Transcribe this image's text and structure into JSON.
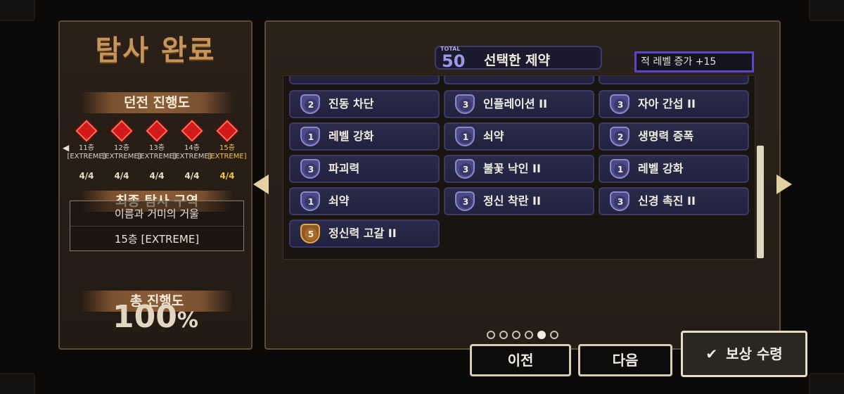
{
  "left_panel": {
    "title": "탐사 완료",
    "dungeon_progress_label": "던전 진행도",
    "floors": [
      {
        "label": "11층\n[EXTREME]",
        "count": "4/4",
        "highlight": false
      },
      {
        "label": "12층\n[EXTREME]",
        "count": "4/4",
        "highlight": false
      },
      {
        "label": "13층\n[EXTREME]",
        "count": "4/4",
        "highlight": false
      },
      {
        "label": "14층\n[EXTREME]",
        "count": "4/4",
        "highlight": false
      },
      {
        "label": "15층\n[EXTREME]",
        "count": "4/4",
        "highlight": true
      }
    ],
    "final_zone_label": "최종 탐사 구역",
    "zone_name": "이름과 거미의 거울",
    "zone_floor": "15층 [EXTREME]",
    "total_progress_label": "총 진행도",
    "total_progress_value": "100",
    "total_progress_unit": "%"
  },
  "main_panel": {
    "total_label": "TOTAL",
    "total_value": "50",
    "selected_title": "선택한 제약",
    "level_increase": "적 레벨 증가 +15",
    "constraints": [
      {
        "level": "2",
        "name": "진동 차단",
        "gold": false
      },
      {
        "level": "3",
        "name": "인플레이션 II",
        "gold": false
      },
      {
        "level": "3",
        "name": "자아 간섭 II",
        "gold": false
      },
      {
        "level": "1",
        "name": "레벨 강화",
        "gold": false
      },
      {
        "level": "1",
        "name": "쇠약",
        "gold": false
      },
      {
        "level": "2",
        "name": "생명력 증폭",
        "gold": false
      },
      {
        "level": "3",
        "name": "파괴력",
        "gold": false
      },
      {
        "level": "3",
        "name": "불꽃 낙인 II",
        "gold": false
      },
      {
        "level": "1",
        "name": "레벨 강화",
        "gold": false
      },
      {
        "level": "1",
        "name": "쇠약",
        "gold": false
      },
      {
        "level": "3",
        "name": "정신 착란 II",
        "gold": false
      },
      {
        "level": "3",
        "name": "신경 촉진 II",
        "gold": false
      },
      {
        "level": "5",
        "name": "정신력 고갈 II",
        "gold": true
      }
    ]
  },
  "pagination": {
    "total_pages": 6,
    "current_page": 5
  },
  "buttons": {
    "prev": "이전",
    "next": "다음",
    "claim": "보상 수령"
  },
  "colors": {
    "accent_gold": "#f2c14a",
    "title_brown": "#c7955a",
    "card_blue": "#2a2a4a",
    "gem_red": "#d21a1a",
    "selection_border": "#5a46c6"
  }
}
